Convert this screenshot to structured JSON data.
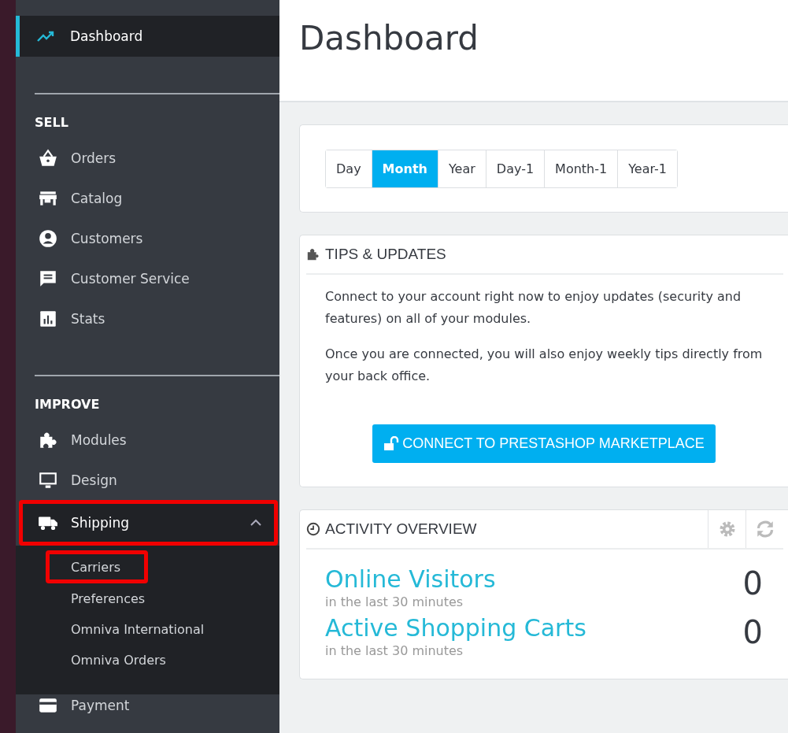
{
  "sidebar": {
    "top_item": {
      "label": "Dashboard",
      "selected": true
    },
    "sections": [
      {
        "title": "SELL",
        "items": [
          {
            "label": "Orders",
            "kind": "basket",
            "expanded": false,
            "highlighted": false
          },
          {
            "label": "Catalog",
            "kind": "store",
            "expanded": false,
            "highlighted": false
          },
          {
            "label": "Customers",
            "kind": "person",
            "expanded": false,
            "highlighted": false
          },
          {
            "label": "Customer Service",
            "kind": "chat",
            "expanded": false,
            "highlighted": false
          },
          {
            "label": "Stats",
            "kind": "chart",
            "expanded": false,
            "highlighted": false
          }
        ]
      },
      {
        "title": "IMPROVE",
        "items": [
          {
            "label": "Modules",
            "kind": "puzzle",
            "expanded": false,
            "highlighted": false
          },
          {
            "label": "Design",
            "kind": "monitor",
            "expanded": false,
            "highlighted": false
          },
          {
            "label": "Shipping",
            "kind": "truck",
            "expanded": true,
            "highlighted": true,
            "children": [
              {
                "label": "Carriers",
                "highlighted": true
              },
              {
                "label": "Preferences",
                "highlighted": false
              },
              {
                "label": "Omniva International",
                "highlighted": false
              },
              {
                "label": "Omniva Orders",
                "highlighted": false
              }
            ]
          },
          {
            "label": "Payment",
            "kind": "card",
            "expanded": false,
            "highlighted": false
          }
        ]
      }
    ]
  },
  "page_title": "Dashboard",
  "period_tabs": [
    {
      "label": "Day",
      "selected": false
    },
    {
      "label": "Month",
      "selected": true
    },
    {
      "label": "Year",
      "selected": false
    },
    {
      "label": "Day-1",
      "selected": false
    },
    {
      "label": "Month-1",
      "selected": false
    },
    {
      "label": "Year-1",
      "selected": false
    }
  ],
  "tips_panel": {
    "title": "TIPS & UPDATES",
    "paragraphs": [
      "Connect to your account right now to enjoy updates (security and features) on all of your modules.",
      "Once you are connected, you will also enjoy weekly tips directly from your back office."
    ],
    "button": "CONNECT TO PRESTASHOP MARKETPLACE"
  },
  "activity_panel": {
    "title": "ACTIVITY OVERVIEW",
    "metrics": [
      {
        "label": "Online Visitors",
        "caption": "in the last 30 minutes",
        "value": "0"
      },
      {
        "label": "Active Shopping Carts",
        "caption": "in the last 30 minutes",
        "value": "0"
      }
    ]
  }
}
